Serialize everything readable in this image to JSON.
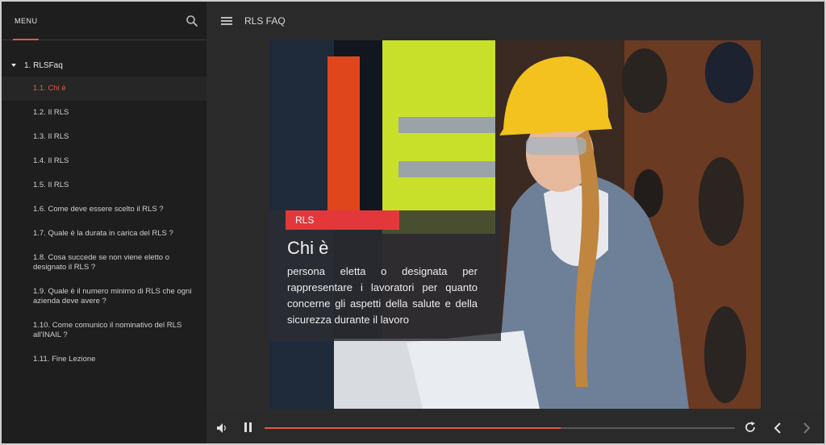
{
  "sidebar": {
    "menu_label": "MENU",
    "root_label": "1. RLSFaq",
    "items": [
      {
        "label": "1.1. Chi è",
        "active": true
      },
      {
        "label": "1.2. Il RLS"
      },
      {
        "label": "1.3. Il RLS"
      },
      {
        "label": "1.4. Il RLS"
      },
      {
        "label": "1.5. Il RLS"
      },
      {
        "label": "1.6. Come deve essere scelto il RLS ?"
      },
      {
        "label": "1.7. Quale è la durata in carica del RLS ?"
      },
      {
        "label": "1.8. Cosa succede se non viene eletto o designato il RLS ?"
      },
      {
        "label": "1.9. Quale è il numero minimo di RLS che ogni azienda deve avere ?"
      },
      {
        "label": "1.10. Come comunico il nominativo del RLS all'INAIL ?"
      },
      {
        "label": "1.11. Fine Lezione"
      }
    ]
  },
  "header": {
    "title": "RLS FAQ"
  },
  "slide": {
    "tag": "RLS",
    "title": "Chi è",
    "text": "persona eletta o designata per rappresentare i lavoratori per quanto concerne gli aspetti della salute e della sicurezza durante il lavoro"
  },
  "player": {
    "progress": 0.63
  },
  "colors": {
    "accent": "#e05a40",
    "tag": "#e3383b"
  },
  "icons": [
    "search-icon",
    "hamburger-icon",
    "volume-icon",
    "pause-icon",
    "reload-icon",
    "chevron-left-icon",
    "chevron-right-icon"
  ]
}
